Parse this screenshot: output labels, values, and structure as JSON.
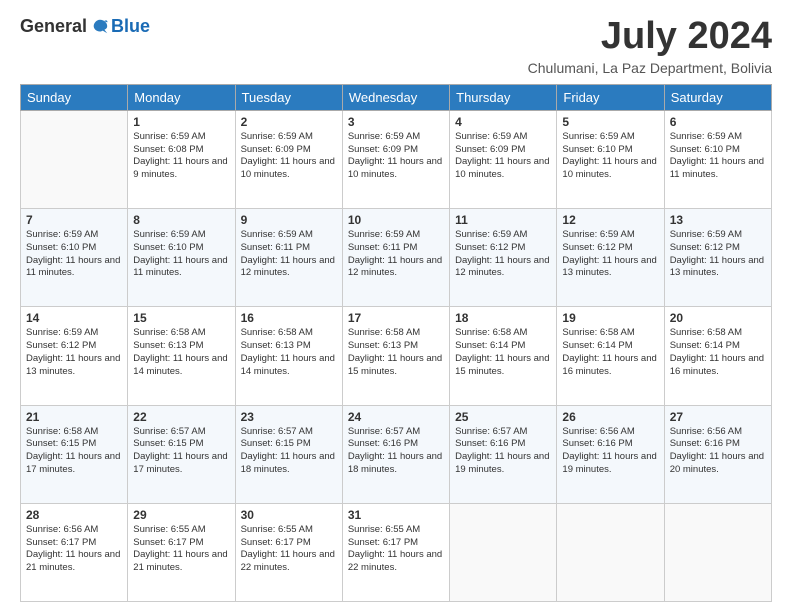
{
  "logo": {
    "general": "General",
    "blue": "Blue"
  },
  "title": "July 2024",
  "subtitle": "Chulumani, La Paz Department, Bolivia",
  "header_days": [
    "Sunday",
    "Monday",
    "Tuesday",
    "Wednesday",
    "Thursday",
    "Friday",
    "Saturday"
  ],
  "weeks": [
    [
      {
        "day": "",
        "sunrise": "",
        "sunset": "",
        "daylight": "",
        "empty": true
      },
      {
        "day": "1",
        "sunrise": "6:59 AM",
        "sunset": "6:08 PM",
        "daylight": "11 hours and 9 minutes."
      },
      {
        "day": "2",
        "sunrise": "6:59 AM",
        "sunset": "6:09 PM",
        "daylight": "11 hours and 10 minutes."
      },
      {
        "day": "3",
        "sunrise": "6:59 AM",
        "sunset": "6:09 PM",
        "daylight": "11 hours and 10 minutes."
      },
      {
        "day": "4",
        "sunrise": "6:59 AM",
        "sunset": "6:09 PM",
        "daylight": "11 hours and 10 minutes."
      },
      {
        "day": "5",
        "sunrise": "6:59 AM",
        "sunset": "6:10 PM",
        "daylight": "11 hours and 10 minutes."
      },
      {
        "day": "6",
        "sunrise": "6:59 AM",
        "sunset": "6:10 PM",
        "daylight": "11 hours and 11 minutes."
      }
    ],
    [
      {
        "day": "7",
        "sunrise": "6:59 AM",
        "sunset": "6:10 PM",
        "daylight": "11 hours and 11 minutes."
      },
      {
        "day": "8",
        "sunrise": "6:59 AM",
        "sunset": "6:10 PM",
        "daylight": "11 hours and 11 minutes."
      },
      {
        "day": "9",
        "sunrise": "6:59 AM",
        "sunset": "6:11 PM",
        "daylight": "11 hours and 12 minutes."
      },
      {
        "day": "10",
        "sunrise": "6:59 AM",
        "sunset": "6:11 PM",
        "daylight": "11 hours and 12 minutes."
      },
      {
        "day": "11",
        "sunrise": "6:59 AM",
        "sunset": "6:12 PM",
        "daylight": "11 hours and 12 minutes."
      },
      {
        "day": "12",
        "sunrise": "6:59 AM",
        "sunset": "6:12 PM",
        "daylight": "11 hours and 13 minutes."
      },
      {
        "day": "13",
        "sunrise": "6:59 AM",
        "sunset": "6:12 PM",
        "daylight": "11 hours and 13 minutes."
      }
    ],
    [
      {
        "day": "14",
        "sunrise": "6:59 AM",
        "sunset": "6:12 PM",
        "daylight": "11 hours and 13 minutes."
      },
      {
        "day": "15",
        "sunrise": "6:58 AM",
        "sunset": "6:13 PM",
        "daylight": "11 hours and 14 minutes."
      },
      {
        "day": "16",
        "sunrise": "6:58 AM",
        "sunset": "6:13 PM",
        "daylight": "11 hours and 14 minutes."
      },
      {
        "day": "17",
        "sunrise": "6:58 AM",
        "sunset": "6:13 PM",
        "daylight": "11 hours and 15 minutes."
      },
      {
        "day": "18",
        "sunrise": "6:58 AM",
        "sunset": "6:14 PM",
        "daylight": "11 hours and 15 minutes."
      },
      {
        "day": "19",
        "sunrise": "6:58 AM",
        "sunset": "6:14 PM",
        "daylight": "11 hours and 16 minutes."
      },
      {
        "day": "20",
        "sunrise": "6:58 AM",
        "sunset": "6:14 PM",
        "daylight": "11 hours and 16 minutes."
      }
    ],
    [
      {
        "day": "21",
        "sunrise": "6:58 AM",
        "sunset": "6:15 PM",
        "daylight": "11 hours and 17 minutes."
      },
      {
        "day": "22",
        "sunrise": "6:57 AM",
        "sunset": "6:15 PM",
        "daylight": "11 hours and 17 minutes."
      },
      {
        "day": "23",
        "sunrise": "6:57 AM",
        "sunset": "6:15 PM",
        "daylight": "11 hours and 18 minutes."
      },
      {
        "day": "24",
        "sunrise": "6:57 AM",
        "sunset": "6:16 PM",
        "daylight": "11 hours and 18 minutes."
      },
      {
        "day": "25",
        "sunrise": "6:57 AM",
        "sunset": "6:16 PM",
        "daylight": "11 hours and 19 minutes."
      },
      {
        "day": "26",
        "sunrise": "6:56 AM",
        "sunset": "6:16 PM",
        "daylight": "11 hours and 19 minutes."
      },
      {
        "day": "27",
        "sunrise": "6:56 AM",
        "sunset": "6:16 PM",
        "daylight": "11 hours and 20 minutes."
      }
    ],
    [
      {
        "day": "28",
        "sunrise": "6:56 AM",
        "sunset": "6:17 PM",
        "daylight": "11 hours and 21 minutes."
      },
      {
        "day": "29",
        "sunrise": "6:55 AM",
        "sunset": "6:17 PM",
        "daylight": "11 hours and 21 minutes."
      },
      {
        "day": "30",
        "sunrise": "6:55 AM",
        "sunset": "6:17 PM",
        "daylight": "11 hours and 22 minutes."
      },
      {
        "day": "31",
        "sunrise": "6:55 AM",
        "sunset": "6:17 PM",
        "daylight": "11 hours and 22 minutes."
      },
      {
        "day": "",
        "sunrise": "",
        "sunset": "",
        "daylight": "",
        "empty": true
      },
      {
        "day": "",
        "sunrise": "",
        "sunset": "",
        "daylight": "",
        "empty": true
      },
      {
        "day": "",
        "sunrise": "",
        "sunset": "",
        "daylight": "",
        "empty": true
      }
    ]
  ]
}
